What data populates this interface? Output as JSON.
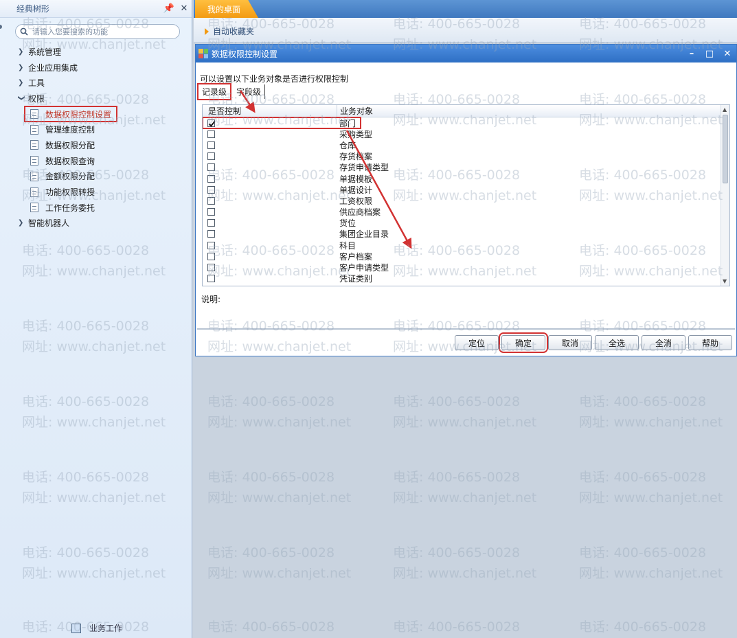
{
  "left_panel": {
    "title": "经典树形",
    "pin_icon": "pin-icon",
    "close_icon": "close-icon",
    "search_placeholder": "请输入您要搜索的功能",
    "tree": [
      {
        "label": "系统管理",
        "level": 1,
        "expanded": false
      },
      {
        "label": "企业应用集成",
        "level": 1,
        "expanded": false
      },
      {
        "label": "工具",
        "level": 1,
        "expanded": false
      },
      {
        "label": "权限",
        "level": 1,
        "expanded": true
      },
      {
        "label": "数据权限控制设置",
        "level": 2,
        "selected": true
      },
      {
        "label": "管理维度控制",
        "level": 2
      },
      {
        "label": "数据权限分配",
        "level": 2
      },
      {
        "label": "数据权限查询",
        "level": 2
      },
      {
        "label": "金额权限分配",
        "level": 2
      },
      {
        "label": "功能权限转授",
        "level": 2
      },
      {
        "label": "工作任务委托",
        "level": 2
      },
      {
        "label": "智能机器人",
        "level": 1,
        "expanded": false
      }
    ],
    "footer_label": "业务工作"
  },
  "top": {
    "tab_label": "我的桌面",
    "favorites_label": "自动收藏夹"
  },
  "dialog": {
    "title": "数据权限控制设置",
    "intro": "可以设置以下业务对象是否进行权限控制",
    "tabs": [
      "记录级",
      "字段级"
    ],
    "columns": [
      "是否控制",
      "业务对象"
    ],
    "rows": [
      {
        "name": "部门",
        "checked": true
      },
      {
        "name": "采购类型",
        "checked": false
      },
      {
        "name": "仓库",
        "checked": false
      },
      {
        "name": "存货档案",
        "checked": false
      },
      {
        "name": "存货申请类型",
        "checked": false
      },
      {
        "name": "单据模板",
        "checked": false
      },
      {
        "name": "单据设计",
        "checked": false
      },
      {
        "name": "工资权限",
        "checked": false
      },
      {
        "name": "供应商档案",
        "checked": false
      },
      {
        "name": "货位",
        "checked": false
      },
      {
        "name": "集团企业目录",
        "checked": false
      },
      {
        "name": "科目",
        "checked": false
      },
      {
        "name": "客户档案",
        "checked": false
      },
      {
        "name": "客户申请类型",
        "checked": false
      },
      {
        "name": "凭证类别",
        "checked": false
      }
    ],
    "explain_label": "说明:",
    "buttons": {
      "locate": "定位",
      "ok": "确定",
      "cancel": "取消",
      "select_all": "全选",
      "clear_all": "全消",
      "help": "帮助"
    }
  },
  "watermark": {
    "phone": "电话: 400-665-0028",
    "site": "网址: www.chanjet.net"
  },
  "colors": {
    "annotation_red": "#d23232",
    "tab_orange": "#f39b12",
    "titlebar_blue": "#2e6fc4"
  }
}
